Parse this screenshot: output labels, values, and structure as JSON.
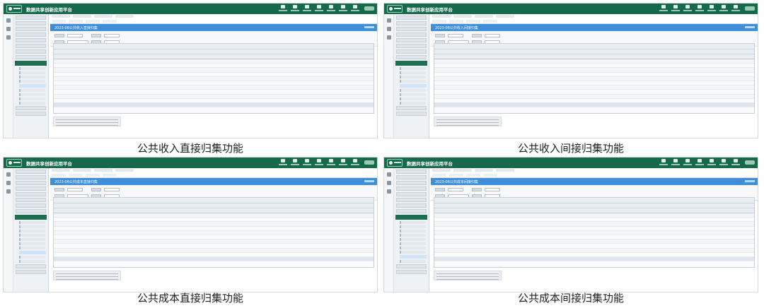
{
  "app": {
    "title": "数据共享创新应用平台"
  },
  "panels": [
    {
      "caption": "公共收入直接归集功能",
      "report_title": "2023-06公共收入直接归集"
    },
    {
      "caption": "公共收入间接归集功能",
      "report_title": "2023-06公共收入间接归集"
    },
    {
      "caption": "公共成本直接归集功能",
      "report_title": "2023-06公共成本直接归集"
    },
    {
      "caption": "公共成本间接归集功能",
      "report_title": "2023-06公共成本间接归集"
    }
  ],
  "colors": {
    "topbar": "#17694c",
    "report_title_bar": "#3f8fd8",
    "sidebar_active": "#1d6f52"
  }
}
